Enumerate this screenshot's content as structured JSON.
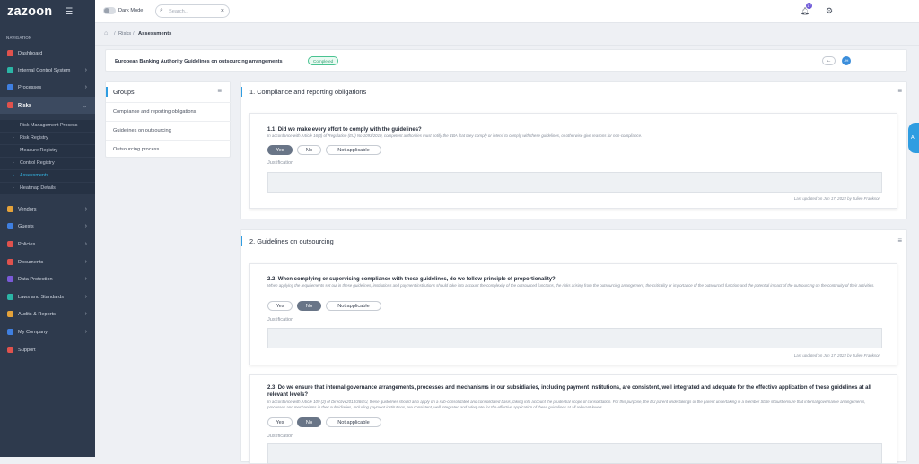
{
  "app": {
    "name": "zazoon"
  },
  "sidebar": {
    "nav_label": "NAVIGATION",
    "items": [
      {
        "label": "Dashboard",
        "icon": "dashboard-icon",
        "color": "#e0524d",
        "chevron": false
      },
      {
        "label": "Internal Control System",
        "icon": "control-icon",
        "color": "#2bb5a6",
        "chevron": true
      },
      {
        "label": "Processes",
        "icon": "process-icon",
        "color": "#3f7fe0",
        "chevron": true
      },
      {
        "label": "Risks",
        "icon": "risk-icon",
        "color": "#e0524d",
        "chevron": true,
        "active": true
      },
      {
        "label": "Vendors",
        "icon": "vendors-icon",
        "color": "#e4a23a",
        "chevron": true
      },
      {
        "label": "Guests",
        "icon": "guests-icon",
        "color": "#3f7fe0",
        "chevron": true
      },
      {
        "label": "Policies",
        "icon": "policies-icon",
        "color": "#e0524d",
        "chevron": true
      },
      {
        "label": "Documents",
        "icon": "documents-icon",
        "color": "#e0524d",
        "chevron": true
      },
      {
        "label": "Data Protection",
        "icon": "data-protection-icon",
        "color": "#7a5ad8",
        "chevron": true
      },
      {
        "label": "Laws and Standards",
        "icon": "laws-icon",
        "color": "#2bb5a6",
        "chevron": true
      },
      {
        "label": "Audits & Reports",
        "icon": "audits-icon",
        "color": "#e4a23a",
        "chevron": true
      },
      {
        "label": "My Company",
        "icon": "company-icon",
        "color": "#3f7fe0",
        "chevron": true
      },
      {
        "label": "Support",
        "icon": "support-icon",
        "color": "#e0524d",
        "chevron": false
      }
    ],
    "risk_sub": [
      {
        "label": "Risk Management Process"
      },
      {
        "label": "Risk Registry"
      },
      {
        "label": "Measure Registry"
      },
      {
        "label": "Control Registry"
      },
      {
        "label": "Assessments",
        "active": true
      },
      {
        "label": "Heatmap Details"
      }
    ]
  },
  "topbar": {
    "dark_mode_label": "Dark Mode",
    "search_placeholder": "Search...",
    "notification_count": "17"
  },
  "breadcrumb": {
    "home_icon": "home-icon",
    "parent": "Risks",
    "current": "Assessments",
    "sep": "/"
  },
  "assessment": {
    "title": "European Banking Authority Guidelines on outsourcing arrangements",
    "status": "Completed",
    "back_label": "←",
    "avatar": "JH"
  },
  "groups": {
    "heading": "Groups",
    "items": [
      "Compliance and reporting obligations",
      "Guidelines on outsourcing",
      "Outsourcing process"
    ]
  },
  "answer_options": {
    "yes": "Yes",
    "no": "No",
    "na": "Not applicable"
  },
  "justification_label": "Justification",
  "sections": [
    {
      "title": "1. Compliance and reporting obligations",
      "questions": [
        {
          "number": "1.1",
          "title": "Did we make every effort to comply with the guidelines?",
          "desc": "In accordance with Article 16(3) of Regulation (EU) No 1093/2010, competent authorities must notify the EBA that they comply or intend to comply with these guidelines, or otherwise give reasons for non-compliance.",
          "selected": "yes",
          "updated": "Last updated on Jun 17, 2022 by Julien Frankson"
        }
      ]
    },
    {
      "title": "2. Guidelines on outsourcing",
      "questions": [
        {
          "number": "2.2",
          "title": "When complying or supervising compliance with these guidelines, do we follow principle of proportionality?",
          "desc": "When applying the requirements set out in these guidelines, institutions and payment institutions should take into account the complexity of the outsourced functions, the risks arising from the outsourcing arrangement, the criticality or importance of the outsourced function and the potential impact of the outsourcing on the continuity of their activities.",
          "selected": "no",
          "updated": "Last updated on Jun 17, 2022 by Julien Frankson"
        },
        {
          "number": "2.3",
          "title": "Do we ensure that internal governance arrangements, processes and mechanisms in our subsidiaries, including payment institutions, are consistent, well integrated and adequate for the effective application of these guidelines at all relevant levels?",
          "desc": "In accordance with Article 109 (2) of Directive2013/36/EU, these guidelines should also apply on a sub-consolidated and consolidated basis, taking into account the prudential scope of consolidation. For this purpose, the EU parent undertakings or the parent undertaking in a Member State should ensure that internal governance arrangements, processes and mechanisms in their subsidiaries, including payment institutions, are consistent, well integrated and adequate for the effective application of these guidelines at all relevant levels.",
          "selected": "no",
          "updated": ""
        }
      ]
    }
  ],
  "ai_tab": "AI"
}
